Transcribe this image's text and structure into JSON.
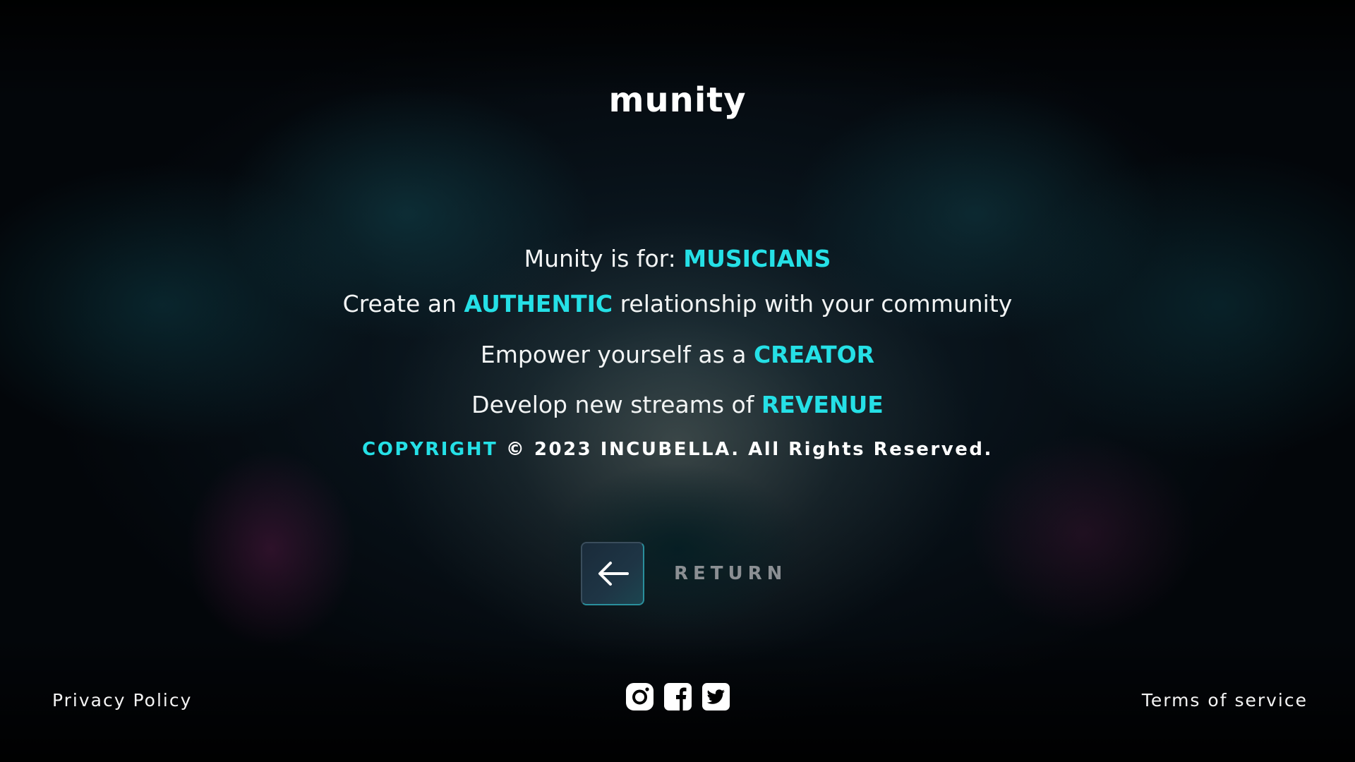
{
  "brand": {
    "logo_text": "munity"
  },
  "taglines": [
    {
      "prefix": "Munity is for: ",
      "accent": "MUSICIANS",
      "suffix": ""
    },
    {
      "prefix": "Create an ",
      "accent": "AUTHENTIC",
      "suffix": " relationship with your community"
    },
    {
      "prefix": "Empower yourself as a ",
      "accent": "CREATOR",
      "suffix": ""
    },
    {
      "prefix": "Develop new streams of ",
      "accent": "REVENUE",
      "suffix": ""
    }
  ],
  "copyright": {
    "accent": "COPYRIGHT",
    "text": " © 2023 INCUBELLA. All Rights Reserved."
  },
  "return_button": {
    "icon": "arrow-left-icon",
    "label": "RETURN"
  },
  "footer": {
    "privacy_label": "Privacy Policy",
    "terms_label": "Terms of service",
    "socials": [
      "instagram-icon",
      "facebook-icon",
      "twitter-icon"
    ]
  },
  "colors": {
    "accent": "#25e0e6",
    "text": "#ffffff",
    "muted": "#8b8f93",
    "background": "#05080c"
  }
}
